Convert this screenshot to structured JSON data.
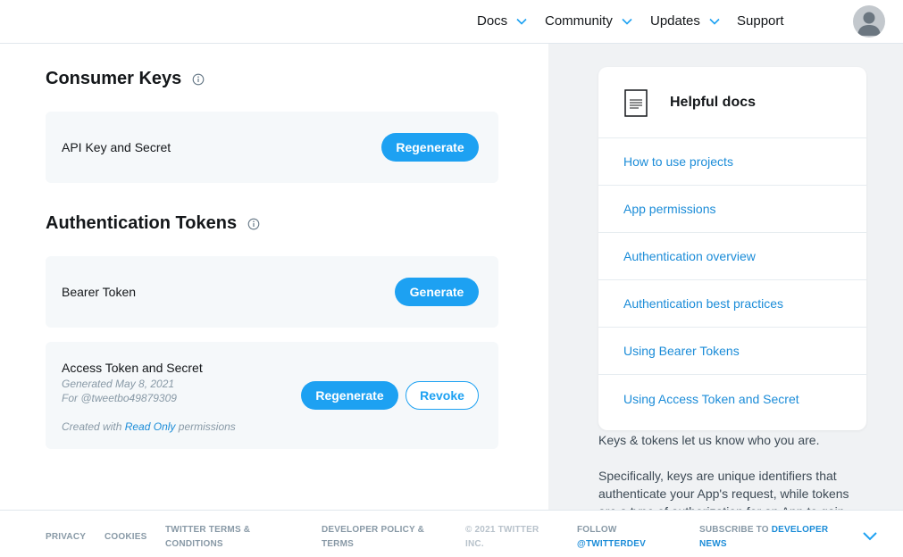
{
  "nav": {
    "items": [
      {
        "label": "Docs",
        "has_dropdown": true
      },
      {
        "label": "Community",
        "has_dropdown": true
      },
      {
        "label": "Updates",
        "has_dropdown": true
      },
      {
        "label": "Support",
        "has_dropdown": false
      }
    ],
    "avatar_icon": "user-avatar-icon"
  },
  "consumer_keys": {
    "title": "Consumer Keys",
    "info_icon": "info-icon",
    "api_key": {
      "label": "API Key and Secret",
      "button": "Regenerate"
    }
  },
  "auth_tokens": {
    "title": "Authentication Tokens",
    "info_icon": "info-icon",
    "bearer": {
      "label": "Bearer Token",
      "button": "Generate"
    },
    "access": {
      "label": "Access Token and Secret",
      "generated": "Generated May 8, 2021",
      "for_user": "For @tweetbo49879309",
      "created_prefix": "Created with",
      "permission": "Read Only",
      "created_suffix": "permissions",
      "regenerate_button": "Regenerate",
      "revoke_button": "Revoke"
    }
  },
  "helpful_docs": {
    "title": "Helpful docs",
    "icon": "document-icon",
    "links": [
      "How to use projects",
      "App permissions",
      "Authentication overview",
      "Authentication best practices",
      "Using Bearer Tokens",
      "Using Access Token and Secret"
    ]
  },
  "about": {
    "p1": "Keys & tokens let us know who you are.",
    "p2": "Specifically, keys are unique identifiers that authenticate your App's request, while tokens are a type of authorization for an App to gain"
  },
  "footer": {
    "privacy": "PRIVACY",
    "cookies": "COOKIES",
    "terms_1": "TWITTER TERMS &",
    "terms_2": "CONDITIONS",
    "policy_1": "DEVELOPER POLICY &",
    "policy_2": "TERMS",
    "copyright_1": "© 2021 TWITTER",
    "copyright_2": "INC.",
    "follow_1": "FOLLOW",
    "follow_2": "@TWITTERDEV",
    "subscribe_prefix": "SUBSCRIBE TO",
    "subscribe_link_1": "DEVELOPER",
    "subscribe_link_2": "NEWS",
    "expand_icon": "chevron-down-icon"
  },
  "colors": {
    "accent": "#1da1f2",
    "link": "#1b8cd8",
    "card_bg": "#f5f8fa",
    "panel_bg": "#f0f2f4"
  }
}
